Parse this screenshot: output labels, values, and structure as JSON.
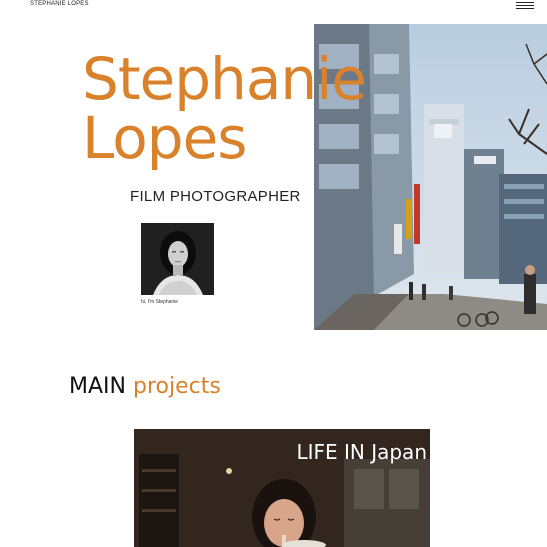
{
  "header": {
    "site_name": "STEPHANIE LOPES",
    "menu_icon": "hamburger-menu-icon"
  },
  "hero": {
    "first_name": "Stephanie",
    "last_name": "Lopes",
    "role": "FILM PHOTOGRAPHER",
    "accent_color": "#d9822b",
    "portrait_caption": "hi, I'm Stephanie"
  },
  "projects": {
    "heading_main": "MAIN",
    "heading_accent": "projects",
    "items": [
      {
        "title": "LIFE IN Japan"
      }
    ]
  }
}
